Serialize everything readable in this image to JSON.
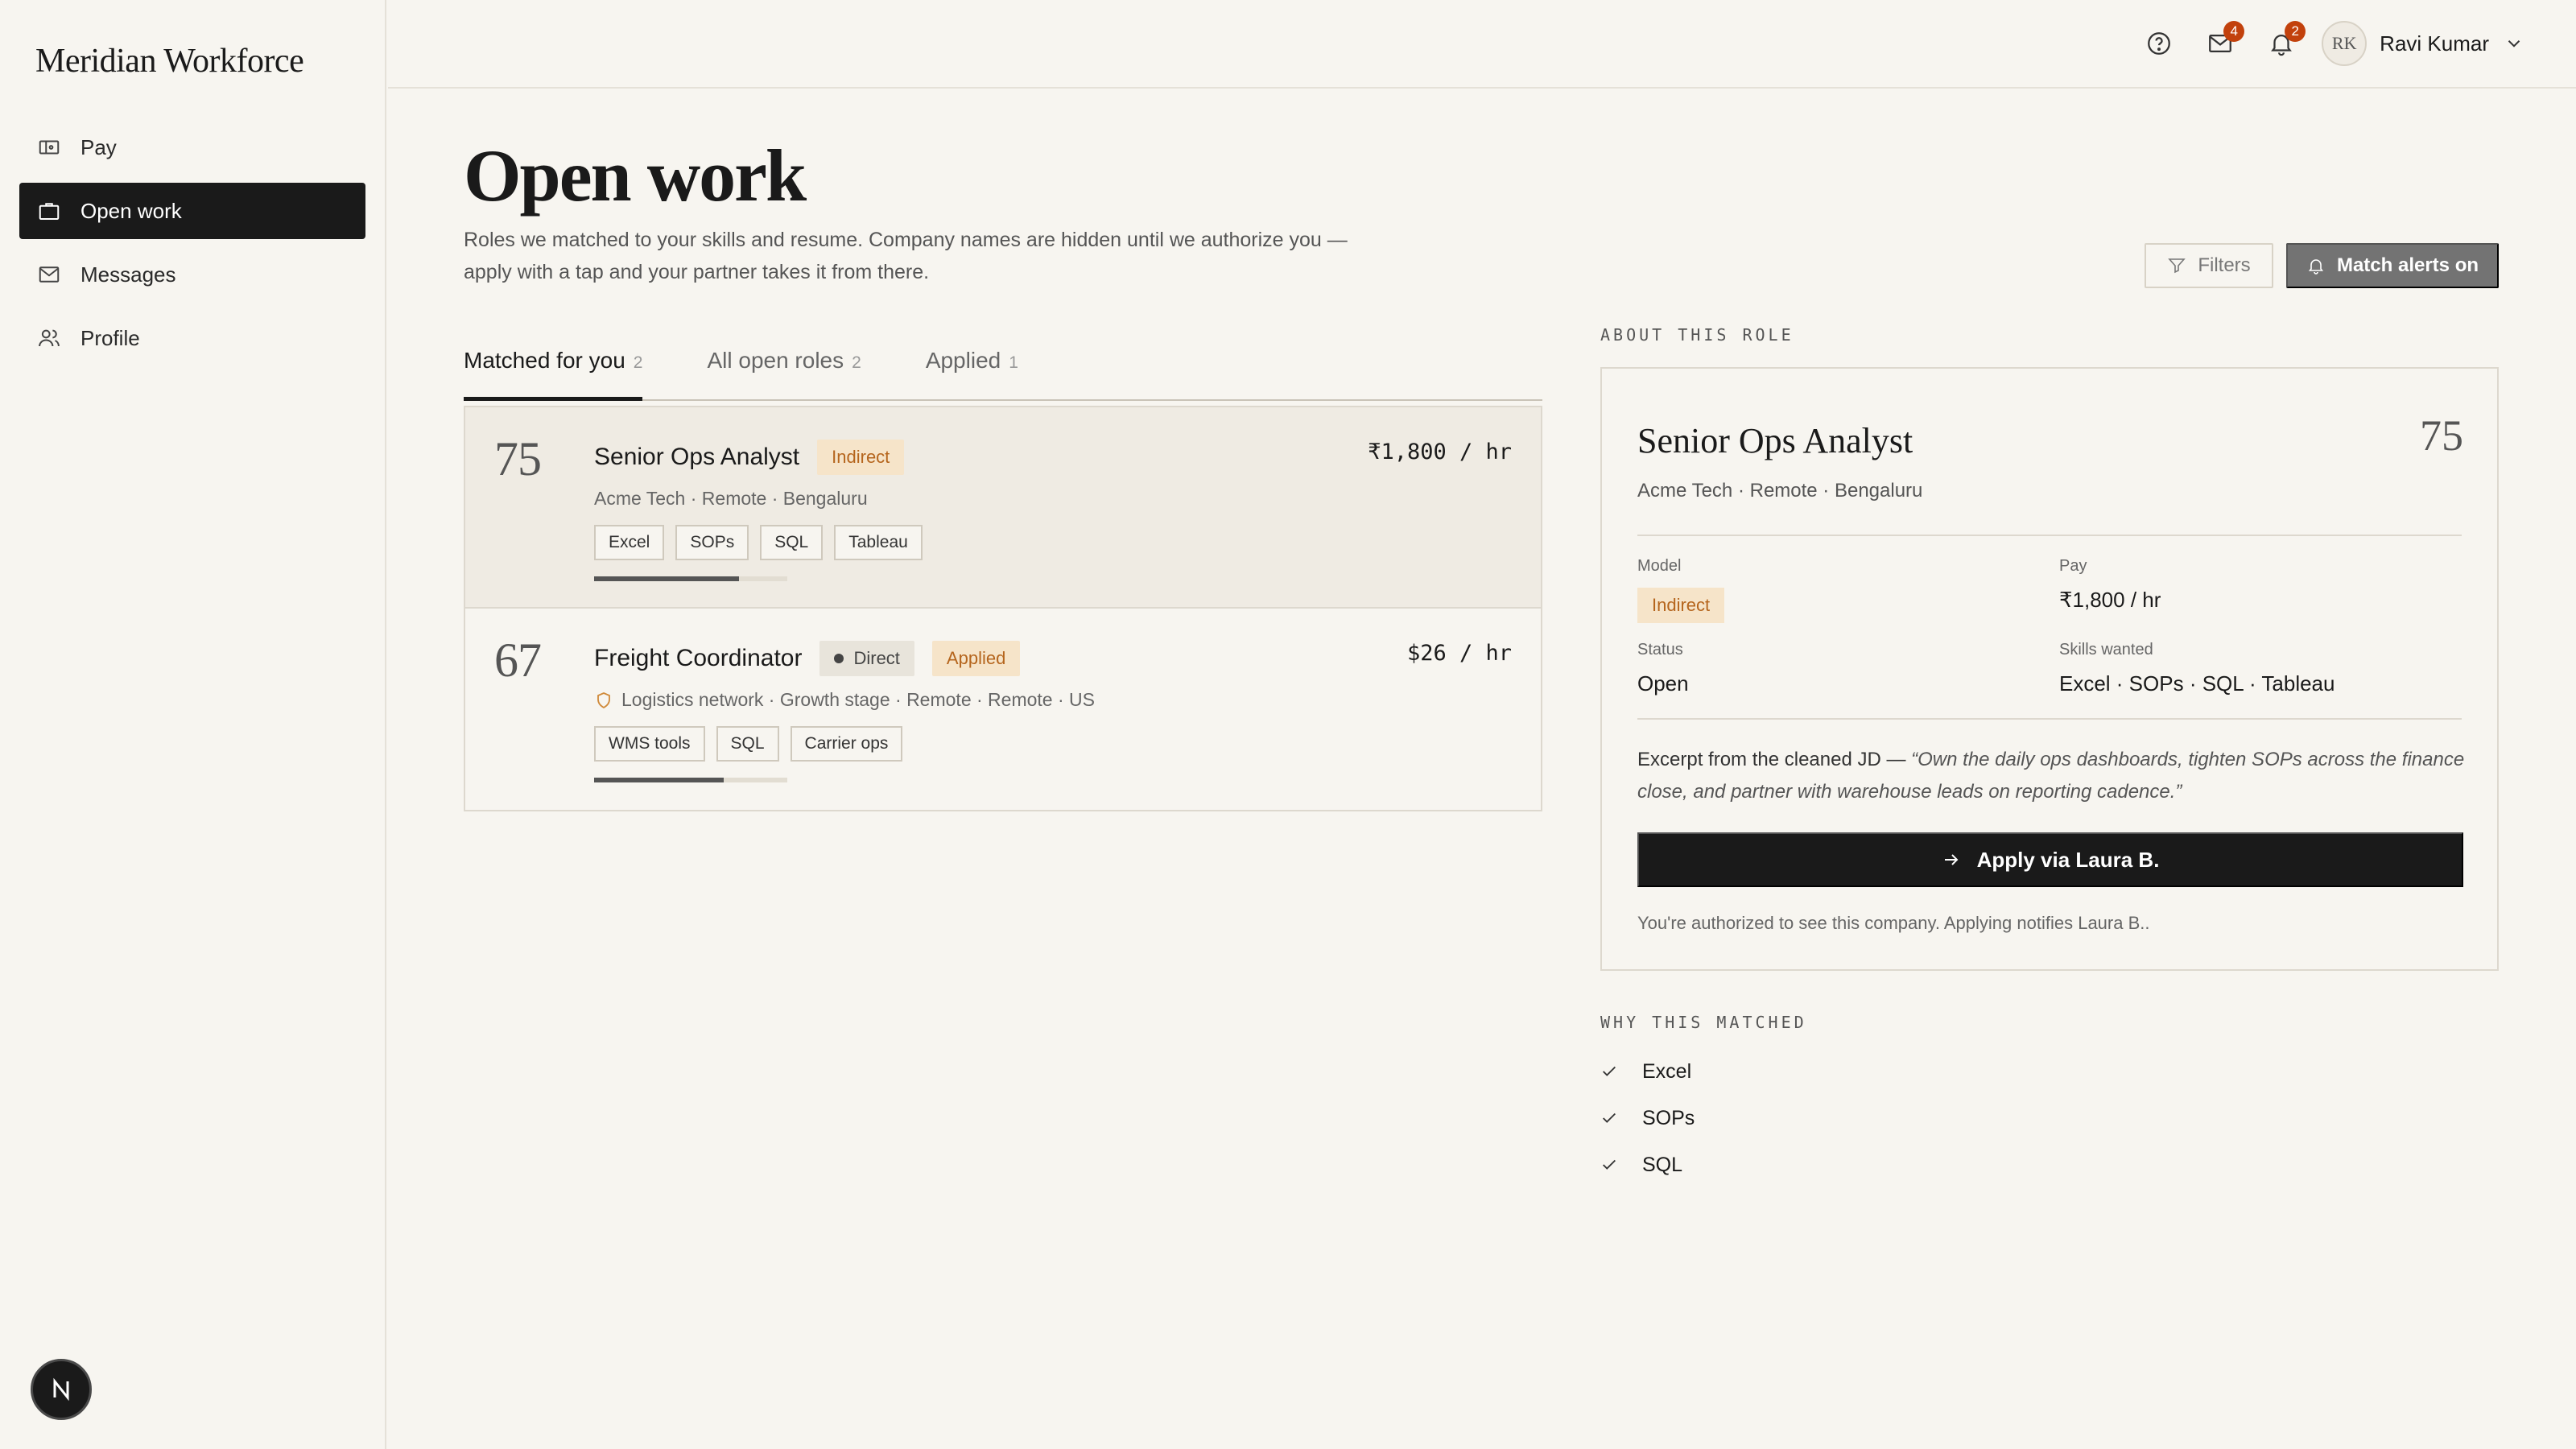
{
  "app": {
    "brand": "Meridian Workforce"
  },
  "sidebar": {
    "items": [
      {
        "label": "Pay",
        "icon": "wallet-icon",
        "active": false
      },
      {
        "label": "Open work",
        "icon": "briefcase-icon",
        "active": true
      },
      {
        "label": "Messages",
        "icon": "mail-icon",
        "active": false
      },
      {
        "label": "Profile",
        "icon": "users-icon",
        "active": false
      }
    ],
    "dev_badge": "N"
  },
  "topbar": {
    "mail_count": "4",
    "notification_count": "2",
    "avatar_initials": "RK",
    "user_name": "Ravi Kumar"
  },
  "header": {
    "title": "Open work",
    "subtitle": "Roles we matched to your skills and resume. Company names are hidden until we authorize you — apply with a tap and your partner takes it from there.",
    "filters_label": "Filters",
    "alerts_label": "Match alerts on"
  },
  "tabs": [
    {
      "label": "Matched for you",
      "count": "2",
      "active": true
    },
    {
      "label": "All open roles",
      "count": "2",
      "active": false
    },
    {
      "label": "Applied",
      "count": "1",
      "active": false
    }
  ],
  "jobs": [
    {
      "score": "75",
      "title": "Senior Ops Analyst",
      "model": "Indirect",
      "meta": "Acme Tech · Remote · Bengaluru",
      "skills": [
        "Excel",
        "SOPs",
        "SQL",
        "Tableau"
      ],
      "pay": "₹1,800 / hr",
      "match": 0.75
    },
    {
      "score": "67",
      "title": "Freight Coordinator",
      "model": "Direct",
      "status": "Applied",
      "meta": "Logistics network · Growth stage · Remote · Remote · US",
      "skills": [
        "WMS tools",
        "SQL",
        "Carrier ops"
      ],
      "pay": "$26 / hr",
      "match": 0.67
    }
  ],
  "detail": {
    "section_label": "ABOUT THIS ROLE",
    "title": "Senior Ops Analyst",
    "score": "75",
    "meta": "Acme Tech · Remote · Bengaluru",
    "model_label": "Model",
    "model_value": "Indirect",
    "pay_label": "Pay",
    "pay_value": "₹1,800 / hr",
    "status_label": "Status",
    "status_value": "Open",
    "skills_label": "Skills wanted",
    "skills_value": "Excel · SOPs · SQL · Tableau",
    "excerpt_prefix": "Excerpt from the cleaned JD — ",
    "excerpt_quote": "“Own the daily ops dashboards, tighten SOPs across the finance close, and partner with warehouse leads on reporting cadence.”",
    "apply_label": "Apply via Laura B.",
    "footnote": "You're authorized to see this company. Applying notifies Laura B.."
  },
  "why": {
    "section_label": "WHY THIS MATCHED",
    "items": [
      "Excel",
      "SOPs",
      "SQL"
    ]
  },
  "colors": {
    "background": "#f7f5f0",
    "ink": "#1a1a1a",
    "accent_badge": "#c2410c",
    "indirect_bg": "#f6e4c9",
    "indirect_text": "#b5651d"
  }
}
